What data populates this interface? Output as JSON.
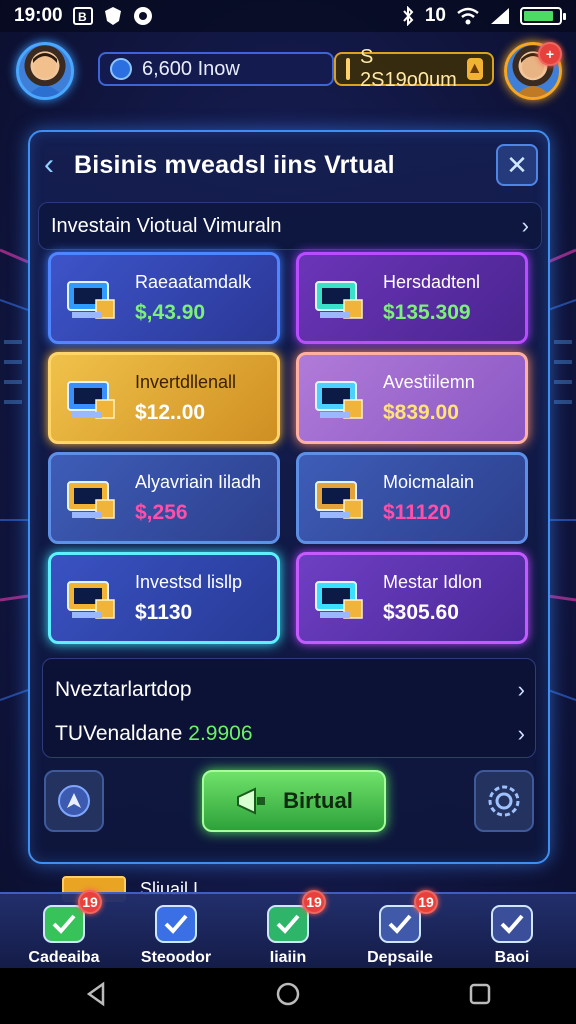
{
  "status_bar": {
    "time": "19:00",
    "left_icons": [
      "b-letter-icon",
      "shield-icon",
      "app-icon"
    ],
    "network": "10",
    "right_icons": [
      "bluetooth-icon",
      "wifi-icon",
      "signal-icon",
      "battery-icon"
    ],
    "battery_level": 0.85
  },
  "top_bar": {
    "currency_a": "6,600 Inow",
    "currency_b": "S 2S19o0um",
    "right_avatar_badge": "+"
  },
  "panel": {
    "title": "Bisinis mveadsl iins Vrtual",
    "section_title": "Investain Viotual Vimuraln",
    "cards": [
      {
        "name": "Raeaatamdalk",
        "price": "$,43.90",
        "style": "blue",
        "icon": "server-stack-icon",
        "price_color": "#7cf07a"
      },
      {
        "name": "Hersdadtenl",
        "price": "$135.309",
        "style": "purple",
        "icon": "laptop-chip-icon",
        "price_color": "#7cf07a"
      },
      {
        "name": "Invertdllenall",
        "price": "$12..00",
        "style": "gold",
        "icon": "monitor-cubes-icon",
        "price_color": "#ffffff"
      },
      {
        "name": "Avestiilemn",
        "price": "$839.00",
        "style": "pink",
        "icon": "chart-dashboard-icon",
        "price_color": "#ffe27a"
      },
      {
        "name": "Alyavriain Iiladh",
        "price": "$,256",
        "style": "steel",
        "icon": "coin-tablet-icon",
        "price_color": "#ff4fa8"
      },
      {
        "name": "Moicmalain",
        "price": "$11120",
        "style": "steel",
        "icon": "crate-icon",
        "price_color": "#ff4fa8"
      },
      {
        "name": "Investsd lisllp",
        "price": "$1130",
        "style": "cyan",
        "icon": "coin-stack-icon",
        "price_color": "#ffffff"
      },
      {
        "name": "Mestar Idlon",
        "price": "$305.60",
        "style": "violet",
        "icon": "laptop-globe-icon",
        "price_color": "#ffffff"
      }
    ],
    "info_rows": [
      {
        "label": "Nveztarlartdop",
        "value": ""
      },
      {
        "label": "TUVenaldane",
        "value": "2.9906"
      }
    ],
    "action_button_label": "Birtual"
  },
  "peek_text": "Sliuail I",
  "bottom_nav": [
    {
      "label": "Cadeaiba",
      "badge": "19",
      "icon": "check-square-icon",
      "color": "#37c25a"
    },
    {
      "label": "Steoodor",
      "badge": "",
      "icon": "check-shield-icon",
      "color": "#3b6fe6"
    },
    {
      "label": "Iiaiin",
      "badge": "19",
      "icon": "search-magnifier-icon",
      "color": "#2fb56a"
    },
    {
      "label": "Depsaile",
      "badge": "19",
      "icon": "person-card-icon",
      "color": "#4059a8"
    },
    {
      "label": "Baoi",
      "badge": "",
      "icon": "bank-gear-icon",
      "color": "#3a4e9a"
    }
  ],
  "android_nav": [
    "back-icon",
    "home-icon",
    "recents-icon"
  ]
}
